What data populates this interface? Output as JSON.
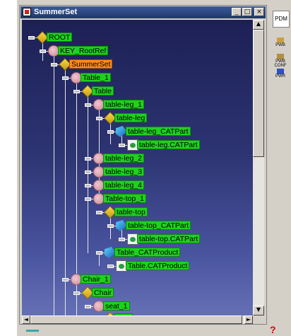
{
  "window": {
    "title": "SummerSet",
    "controls": {
      "minimize": "_",
      "maximize": "□",
      "close": "×"
    }
  },
  "tree": {
    "nodes": [
      {
        "label": "ROOT",
        "icon": "part-icon",
        "selected": false
      },
      {
        "label": "KEY_RootRef",
        "icon": "product-icon",
        "selected": false
      },
      {
        "label": "SummerSet",
        "icon": "part-icon",
        "selected": true
      },
      {
        "label": "Table_1",
        "icon": "product-icon",
        "selected": false
      },
      {
        "label": "Table",
        "icon": "part-icon",
        "selected": false
      },
      {
        "label": "table-leg_1",
        "icon": "product-icon",
        "selected": false
      },
      {
        "label": "table-leg",
        "icon": "part-icon",
        "selected": false
      },
      {
        "label": "table-leg_CATPart",
        "icon": "catia-icon",
        "selected": false
      },
      {
        "label": "table-leg.CATPart",
        "icon": "document-icon",
        "selected": false
      },
      {
        "label": "table-leg_2",
        "icon": "product-icon",
        "selected": false
      },
      {
        "label": "table-leg_3",
        "icon": "product-icon",
        "selected": false
      },
      {
        "label": "table-leg_4",
        "icon": "product-icon",
        "selected": false
      },
      {
        "label": "Table-top_1",
        "icon": "product-icon",
        "selected": false
      },
      {
        "label": "table-top",
        "icon": "part-icon",
        "selected": false
      },
      {
        "label": "table-top_CATPart",
        "icon": "catia-icon",
        "selected": false
      },
      {
        "label": "table-top.CATPart",
        "icon": "document-icon",
        "selected": false
      },
      {
        "label": "Table_CATProduct",
        "icon": "catia-icon",
        "selected": false
      },
      {
        "label": "Table.CATProduct",
        "icon": "document-icon",
        "selected": false
      },
      {
        "label": "Chair_1",
        "icon": "product-icon",
        "selected": false
      },
      {
        "label": "Chair",
        "icon": "part-icon",
        "selected": false
      },
      {
        "label": "seat_1",
        "icon": "product-icon",
        "selected": false
      },
      {
        "label": "seat",
        "icon": "part-icon",
        "selected": false
      }
    ]
  },
  "right_toolbar": {
    "pdm_label": "PDM",
    "icons": [
      {
        "name": "pwb-icon",
        "label": "PWB"
      },
      {
        "name": "pwb-conf-icon",
        "label": "PWB CONF"
      },
      {
        "name": "pwr-icon",
        "label": "PWR"
      }
    ]
  },
  "scrollbars": {
    "up": "▲",
    "down": "▼",
    "left": "◄",
    "right": "►"
  }
}
